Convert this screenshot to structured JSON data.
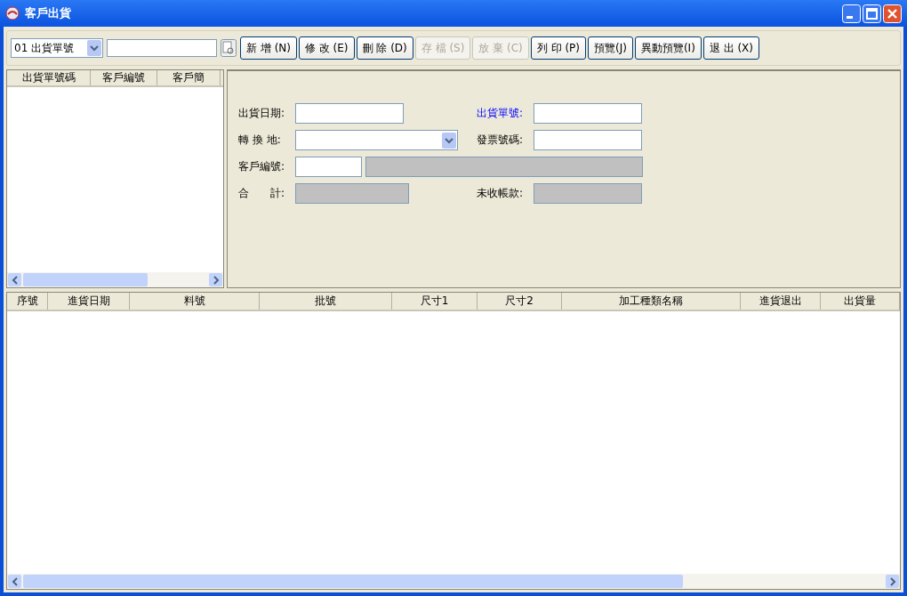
{
  "window": {
    "title": "客戶出貨"
  },
  "toolbar": {
    "search_by": "01 出貨單號",
    "buttons": [
      {
        "label": "新 增 (N)",
        "disabled": false
      },
      {
        "label": "修 改 (E)",
        "disabled": false
      },
      {
        "label": "刪 除 (D)",
        "disabled": false
      },
      {
        "label": "存 檔 (S)",
        "disabled": true
      },
      {
        "label": "放 棄 (C)",
        "disabled": true
      },
      {
        "label": "列 印 (P)",
        "disabled": false
      },
      {
        "label": "預覽(J)",
        "disabled": false
      },
      {
        "label": "異動預覽(I)",
        "disabled": false
      },
      {
        "label": "退 出 (X)",
        "disabled": false
      }
    ]
  },
  "list": {
    "columns": [
      "出貨單號碼",
      "客戶編號",
      "客戶簡"
    ]
  },
  "form": {
    "rows": [
      {
        "groups": [
          {
            "label": "出貨日期:",
            "highlighted": false,
            "fields": [
              {
                "kind": "text",
                "disabled": false
              }
            ]
          },
          {
            "label": "出貨單號:",
            "highlighted": true,
            "fields": [
              {
                "kind": "text",
                "disabled": false
              }
            ]
          }
        ]
      },
      {
        "groups": [
          {
            "label": "轉 換 地:",
            "highlighted": false,
            "fields": [
              {
                "kind": "combo",
                "disabled": false
              }
            ]
          },
          {
            "label": "發票號碼:",
            "highlighted": false,
            "fields": [
              {
                "kind": "text",
                "disabled": false
              }
            ]
          }
        ]
      },
      {
        "groups": [
          {
            "label": "客戶編號:",
            "highlighted": false,
            "fields": [
              {
                "kind": "code",
                "disabled": false
              },
              {
                "kind": "name",
                "disabled": true
              }
            ]
          }
        ]
      },
      {
        "groups": [
          {
            "label": "合　　計:",
            "highlighted": false,
            "fields": [
              {
                "kind": "total",
                "disabled": true
              }
            ]
          },
          {
            "label": "未收帳款:",
            "highlighted": false,
            "fields": [
              {
                "kind": "text",
                "disabled": true
              }
            ]
          }
        ]
      }
    ]
  },
  "grid": {
    "columns": [
      "序號",
      "進貨日期",
      "料號",
      "批號",
      "尺寸1",
      "尺寸2",
      "加工種類名稱",
      "進貨退出",
      "出貨量"
    ]
  }
}
